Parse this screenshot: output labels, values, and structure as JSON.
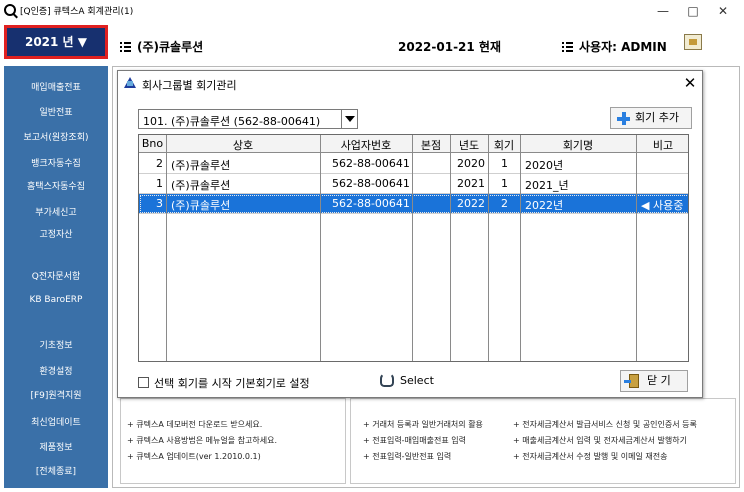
{
  "window": {
    "title": "[Q인증] 큐텍스A   회계관리(1)",
    "minimize": "—",
    "maximize": "□",
    "close": "✕"
  },
  "header": {
    "year_button": "2021 년 ▼",
    "company": "(주)큐솔루션",
    "date": "2022-01-21 현재",
    "user": "사용자: ADMIN"
  },
  "sidebar": {
    "items": [
      "매입매출전표",
      "일반전표",
      "보고서(원장조회)",
      "뱅크자동수집",
      "홈택스자동수집",
      "부가세신고",
      "고정자산",
      "Q전자문서함",
      "KB BaroERP",
      "기초정보",
      "환경설정",
      "[F9]원격지원",
      "최신업데이트",
      "제품정보",
      "[전체종료]"
    ]
  },
  "bottom_panel": {
    "left_lines": [
      "+ 큐텍스A 데모버전 다운로드 받으세요.",
      "+ 큐텍스A 사용방법은 메뉴얼을 참고하세요.",
      "+ 큐텍스A 업데이트(ver 1.2010.0.1)"
    ],
    "mid_lines": [
      "+ 거래처 등록과 일반거래처의 활용",
      "+ 전표입력-매입매출전표 입력",
      "+ 전표입력-일반전표 입력"
    ],
    "right_lines": [
      "+ 전자세금계산서 발급서비스 신청 및 공인인증서 등록",
      "+ 매출세금계산서 입력 및 전자세금계산서 발행하기",
      "+ 전자세금계산서 수정 발행 및 이메일 재전송"
    ]
  },
  "dialog": {
    "title": "회사그룹별 회기관리",
    "close": "✕",
    "company_select": "101. (주)큐솔루션 (562-88-00641)",
    "add_button": "회기 추가",
    "columns": [
      "Bno",
      "상호",
      "사업자번호",
      "본점",
      "년도",
      "회기",
      "회기명",
      "비고"
    ],
    "rows": [
      {
        "bno": "2",
        "name": "(주)큐솔루션",
        "biz": "562-88-00641",
        "hq": "",
        "year": "2020",
        "term": "1",
        "term_name": "2020년",
        "note": "",
        "selected": false
      },
      {
        "bno": "1",
        "name": "(주)큐솔루션",
        "biz": "562-88-00641",
        "hq": "",
        "year": "2021",
        "term": "1",
        "term_name": "2021_년",
        "note": "",
        "selected": false
      },
      {
        "bno": "3",
        "name": "(주)큐솔루션",
        "biz": "562-88-00641",
        "hq": "",
        "year": "2022",
        "term": "2",
        "term_name": "2022년",
        "note": "◀ 사용중",
        "selected": true
      }
    ],
    "checkbox_label": "선택 회기를 시작 기본회기로 설정",
    "select_label": "Select",
    "close_button": "닫 기"
  }
}
